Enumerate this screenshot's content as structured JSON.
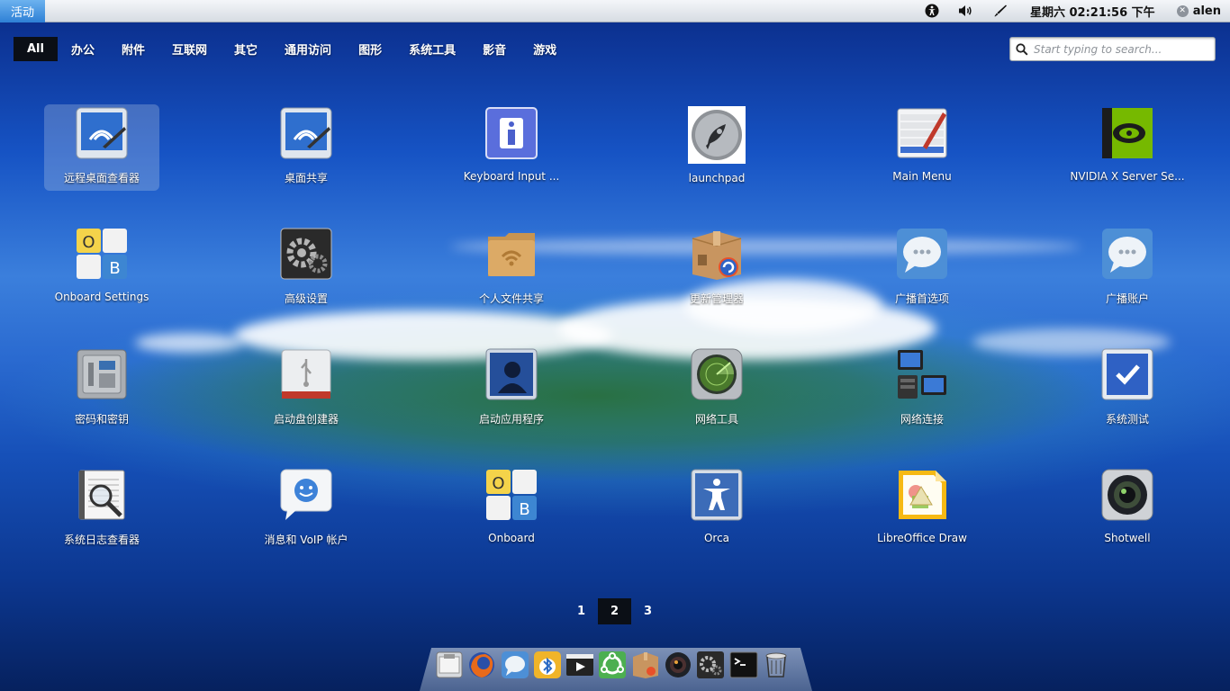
{
  "panel": {
    "activities": "活动",
    "clock": "星期六 02:21:56 下午",
    "user": "alen"
  },
  "categories": [
    "All",
    "办公",
    "附件",
    "互联网",
    "其它",
    "通用访问",
    "图形",
    "系统工具",
    "影音",
    "游戏"
  ],
  "search": {
    "placeholder": "Start typing to search..."
  },
  "apps": [
    {
      "label": "远程桌面查看器",
      "icon": "remote-desktop-icon"
    },
    {
      "label": "桌面共享",
      "icon": "desktop-sharing-icon"
    },
    {
      "label": "Keyboard Input ...",
      "icon": "info-icon"
    },
    {
      "label": "launchpad",
      "icon": "rocket-icon"
    },
    {
      "label": "Main Menu",
      "icon": "menu-editor-icon"
    },
    {
      "label": "NVIDIA X Server Se...",
      "icon": "nvidia-icon"
    },
    {
      "label": "Onboard Settings",
      "icon": "onboard-settings-icon"
    },
    {
      "label": "高级设置",
      "icon": "gears-icon"
    },
    {
      "label": "个人文件共享",
      "icon": "shared-folder-icon"
    },
    {
      "label": "更新管理器",
      "icon": "update-box-icon"
    },
    {
      "label": "广播首选项",
      "icon": "chat-bubbles-icon"
    },
    {
      "label": "广播账户",
      "icon": "chat-bubbles-icon"
    },
    {
      "label": "密码和密钥",
      "icon": "safe-icon"
    },
    {
      "label": "启动盘创建器",
      "icon": "usb-drive-icon"
    },
    {
      "label": "启动应用程序",
      "icon": "user-silhouette-icon"
    },
    {
      "label": "网络工具",
      "icon": "radar-icon"
    },
    {
      "label": "网络连接",
      "icon": "network-monitors-icon"
    },
    {
      "label": "系统测试",
      "icon": "checkbox-icon"
    },
    {
      "label": "系统日志查看器",
      "icon": "log-magnifier-icon"
    },
    {
      "label": "消息和 VoIP 帐户",
      "icon": "smiley-bubble-icon"
    },
    {
      "label": "Onboard",
      "icon": "onboard-icon"
    },
    {
      "label": "Orca",
      "icon": "accessibility-icon"
    },
    {
      "label": "LibreOffice Draw",
      "icon": "draw-icon"
    },
    {
      "label": "Shotwell",
      "icon": "camera-lens-icon"
    }
  ],
  "pager": [
    "1",
    "2",
    "3"
  ],
  "active_page": "2",
  "dock": [
    "files-icon",
    "firefox-icon",
    "empathy-icon",
    "bluetooth-icon",
    "video-icon",
    "ubuntu-icon",
    "software-center-icon",
    "shotwell-icon",
    "gears-icon",
    "terminal-icon",
    "trash-icon"
  ]
}
